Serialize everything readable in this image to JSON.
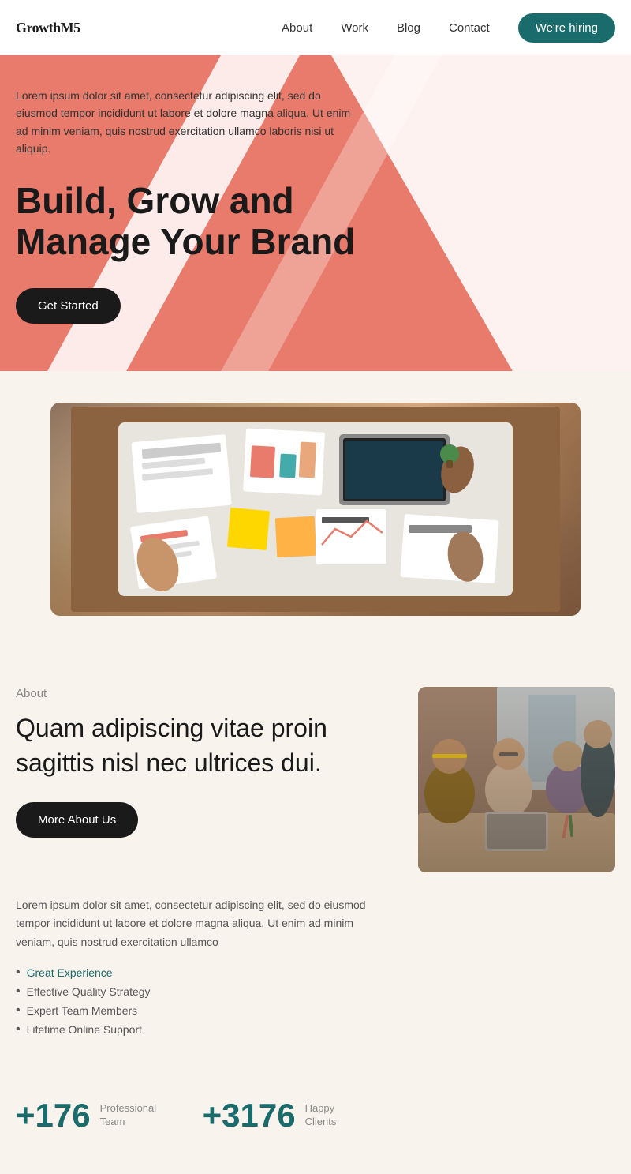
{
  "nav": {
    "logo": "GrowthM5",
    "links": [
      {
        "label": "About",
        "href": "#"
      },
      {
        "label": "Work",
        "href": "#"
      },
      {
        "label": "Blog",
        "href": "#"
      },
      {
        "label": "Contact",
        "href": "#"
      }
    ],
    "cta": "We're hiring"
  },
  "hero": {
    "text": "Lorem ipsum dolor sit amet, consectetur adipiscing elit, sed do eiusmod tempor incididunt ut labore et dolore magna aliqua. Ut enim ad minim veniam, quis nostrud exercitation ullamco laboris nisi ut aliquip.",
    "title_line1": "Build, Grow and",
    "title_line2": "Manage Your Brand",
    "cta": "Get Started"
  },
  "about": {
    "label": "About",
    "heading": "Quam adipiscing vitae proin sagittis nisl nec ultrices dui.",
    "cta": "More About Us",
    "body_text": "Lorem ipsum dolor sit amet, consectetur adipiscing elit, sed do eiusmod tempor incididunt ut labore et dolore magna aliqua. Ut enim ad minim veniam, quis nostrud exercitation ullamco",
    "features": [
      {
        "label": "Great Experience",
        "link": true
      },
      {
        "label": "Effective Quality Strategy",
        "link": false
      },
      {
        "label": "Expert Team Members",
        "link": false
      },
      {
        "label": "Lifetime Online Support",
        "link": false
      }
    ]
  },
  "stats": [
    {
      "number": "+176",
      "label": "Professional Team"
    },
    {
      "number": "+3176",
      "label": "Happy Clients"
    }
  ],
  "colors": {
    "salmon": "#e87b6b",
    "teal": "#1a6b6b",
    "dark": "#1a1a1a",
    "cream": "#f9f3ee"
  }
}
